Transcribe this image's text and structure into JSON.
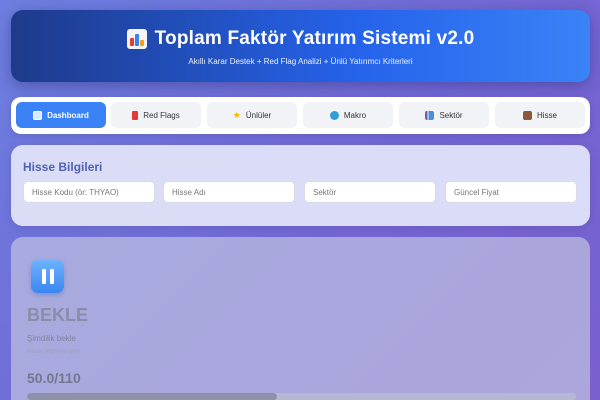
{
  "header": {
    "title": "Toplam Faktör Yatırım Sistemi v2.0",
    "subtitle": "Akıllı Karar Destek + Red Flag Analizi + Ünlü Yatırımcı Kriterleri",
    "icon": "bar-chart-icon"
  },
  "tabs": [
    {
      "label": "Dashboard",
      "icon": "dashboard-icon",
      "active": true
    },
    {
      "label": "Red Flags",
      "icon": "red-flag-icon"
    },
    {
      "label": "Ünlüler",
      "icon": "star-icon"
    },
    {
      "label": "Makro",
      "icon": "globe-icon"
    },
    {
      "label": "Sektör",
      "icon": "sector-chart-icon"
    },
    {
      "label": "Hisse",
      "icon": "briefcase-icon"
    }
  ],
  "stock_info": {
    "title": "Hisse Bilgileri",
    "code_placeholder": "Hisse Kodu (ör: THYAO)",
    "name_placeholder": "Hisse Adı",
    "sector_placeholder": "Sektör",
    "price_placeholder": "Güncel Fiyat"
  },
  "result": {
    "decision": "BEKLE",
    "note": "Şimdilik bekle",
    "hint": "Hisse bilgilerini girin",
    "score": "50.0/110",
    "progress_fraction": 0.4545,
    "icon": "pause-icon"
  },
  "colors": {
    "accent": "#3b82f6",
    "header_dark": "#1e3a8a",
    "background": "#7367d4"
  }
}
